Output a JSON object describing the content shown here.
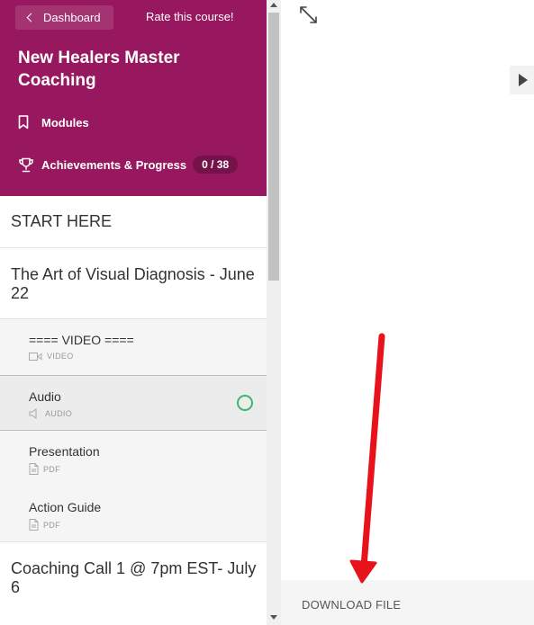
{
  "header": {
    "back_label": "Dashboard",
    "rate_label": "Rate this course!",
    "course_title": "New Healers Master Coaching",
    "modules_label": "Modules",
    "achievements_label": "Achievements & Progress",
    "progress_badge": "0 / 38",
    "bg_color": "#97185e"
  },
  "sections": {
    "start_here": "START HERE",
    "art_visual": "The Art of Visual Diagnosis - June 22",
    "coaching_call": "Coaching Call 1 @ 7pm EST- July 6"
  },
  "lessons": [
    {
      "title": "==== VIDEO ====",
      "type": "VIDEO",
      "icon": "video-icon"
    },
    {
      "title": "Audio",
      "type": "AUDIO",
      "icon": "audio-icon",
      "active": true
    },
    {
      "title": "Presentation",
      "type": "PDF",
      "icon": "pdf-icon"
    },
    {
      "title": "Action Guide",
      "type": "PDF",
      "icon": "pdf-icon"
    }
  ],
  "main": {
    "download_label": "DOWNLOAD FILE",
    "annotation_color": "#e8121a"
  }
}
